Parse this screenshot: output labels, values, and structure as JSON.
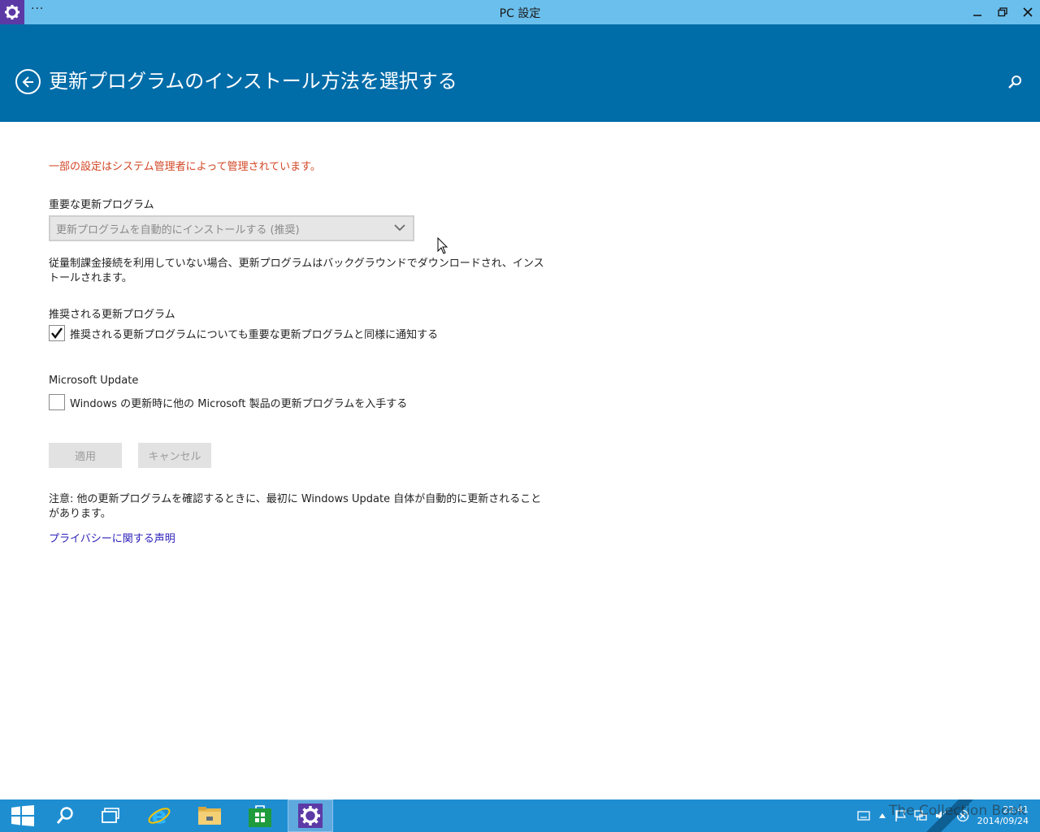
{
  "window": {
    "title": "PC 設定",
    "menu_glyph": "···"
  },
  "header": {
    "title": "更新プログラムのインストール方法を選択する"
  },
  "notice": "一部の設定はシステム管理者によって管理されています。",
  "important_updates": {
    "label": "重要な更新プログラム",
    "dropdown_value": "更新プログラムを自動的にインストールする (推奨)",
    "description": "従量制課金接続を利用していない場合、更新プログラムはバックグラウンドでダウンロードされ、インストールされます。"
  },
  "recommended_updates": {
    "label": "推奨される更新プログラム",
    "checkbox_label": "推奨される更新プログラムについても重要な更新プログラムと同様に通知する",
    "checked": true
  },
  "microsoft_update": {
    "label": "Microsoft Update",
    "checkbox_label": "Windows の更新時に他の Microsoft 製品の更新プログラムを入手する",
    "checked": false
  },
  "buttons": {
    "apply": "適用",
    "cancel": "キャンセル"
  },
  "note": "注意: 他の更新プログラムを確認するときに、最初に Windows Update 自体が自動的に更新されることがあります。",
  "privacy_link": "プライバシーに関する声明",
  "taskbar": {
    "clock_time": "22:41",
    "clock_date": "2014/09/24",
    "watermark": "The Collection Book"
  },
  "colors": {
    "titlebar": "#6bbfec",
    "header": "#006ca8",
    "notice": "#d24726",
    "link": "#2a1fb8",
    "taskbar": "#1f8ed1",
    "app_icon": "#5c3aa6"
  }
}
